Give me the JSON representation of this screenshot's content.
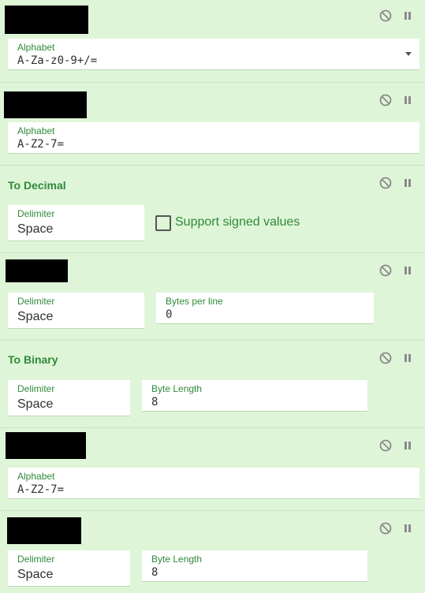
{
  "operations": [
    {
      "title": "",
      "fields": [
        {
          "label": "Alphabet",
          "value": "A-Za-z0-9+/="
        }
      ]
    },
    {
      "title": "",
      "fields": [
        {
          "label": "Alphabet",
          "value": "A-Z2-7="
        }
      ]
    },
    {
      "title": "To Decimal",
      "fields": [
        {
          "label": "Delimiter",
          "value": "Space"
        }
      ],
      "checkbox": {
        "label": "Support signed values",
        "checked": false
      }
    },
    {
      "title": "",
      "fields": [
        {
          "label": "Delimiter",
          "value": "Space"
        },
        {
          "label": "Bytes per line",
          "value": "0"
        }
      ]
    },
    {
      "title": "To Binary",
      "fields": [
        {
          "label": "Delimiter",
          "value": "Space"
        },
        {
          "label": "Byte Length",
          "value": "8"
        }
      ]
    },
    {
      "title": "",
      "fields": [
        {
          "label": "Alphabet",
          "value": "A-Z2-7="
        }
      ]
    },
    {
      "title": "",
      "fields": [
        {
          "label": "Delimiter",
          "value": "Space"
        },
        {
          "label": "Byte Length",
          "value": "8"
        }
      ]
    }
  ],
  "icons": {
    "disable": "disable-icon",
    "breakpoint": "pause-icon"
  },
  "colors": {
    "background": "#dff5d8",
    "accent": "#2f8a3a",
    "redaction": "#000000"
  }
}
